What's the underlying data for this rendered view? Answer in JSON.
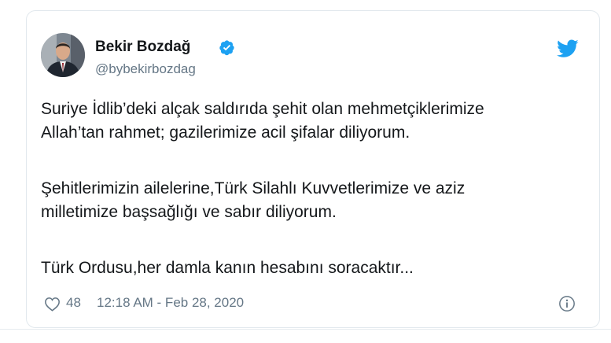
{
  "tweet": {
    "author_name": "Bekir Bozdağ",
    "handle": "@bybekirbozdag",
    "verified": true,
    "lines": [
      "Suriye İdlib’deki alçak saldırıda şehit olan mehmetçiklerimize",
      "Allah’tan rahmet; gazilerimize acil şifalar diliyorum.",
      "Şehitlerimizin ailelerine,Türk Silahlı Kuvvetlerimize ve aziz",
      "milletimize başsağlığı ve sabır diliyorum.",
      "Türk Ordusu,her damla kanın hesabını soracaktır..."
    ],
    "like_count": "48",
    "timestamp": "12:18 AM - Feb 28, 2020"
  },
  "icons": {
    "brand": "twitter-bird-icon",
    "verified": "verified-badge-icon",
    "like": "heart-icon",
    "info": "info-icon"
  },
  "colors": {
    "twitter_blue": "#1da1f2",
    "text_primary": "#14171a",
    "text_secondary": "#657786",
    "border": "#e1e8ed"
  }
}
